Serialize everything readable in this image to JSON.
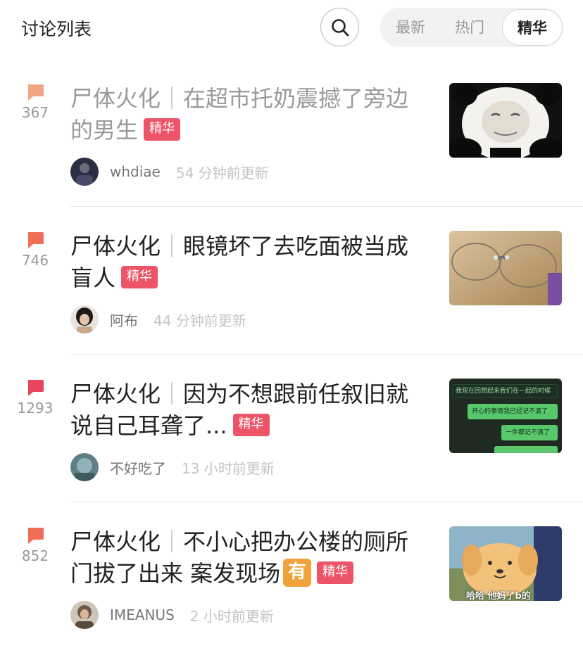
{
  "header": {
    "title": "讨论列表",
    "tabs": [
      "最新",
      "热门",
      "精华"
    ],
    "active_tab": "精华"
  },
  "posts": [
    {
      "count": "367",
      "prefix": "尸体火化",
      "separator": "｜",
      "title": "在超市托奶震撼了旁边的男生",
      "badge": "精华",
      "author": "whdiae",
      "time": "54 分钟前更新",
      "bubble_color": "#f3a483",
      "thumbnail": "panda-meme-image"
    },
    {
      "count": "746",
      "prefix": "尸体火化",
      "separator": "｜",
      "title": "眼镜坏了去吃面被当成盲人",
      "badge": "精华",
      "author": "阿布",
      "time": "44 分钟前更新",
      "bubble_color": "#ee6e58",
      "thumbnail": "broken-glasses-image"
    },
    {
      "count": "1293",
      "prefix": "尸体火化",
      "separator": "｜",
      "title": "因为不想跟前任叙旧就说自己耳聋了...",
      "badge": "精华",
      "author": "不好吃了",
      "time": "13 小时前更新",
      "bubble_color": "#e8455c",
      "thumbnail": "chat-screenshot-image",
      "thumbnail_text": [
        "我现在回想起来我们在一起的时候",
        "开心的事情我已经记不清了",
        "一件都记不清了"
      ]
    },
    {
      "count": "852",
      "prefix": "尸体火化",
      "separator": "｜",
      "title": "不小心把办公楼的厕所门拔了出来 案发现场",
      "you_badge": "有",
      "badge": "精华",
      "author": "IMEANUS",
      "time": "2 小时前更新",
      "bubble_color": "#ee6e58",
      "thumbnail": "cartoon-dog-image",
      "thumbnail_text": [
        "哈哈 他妈了b的"
      ]
    }
  ]
}
